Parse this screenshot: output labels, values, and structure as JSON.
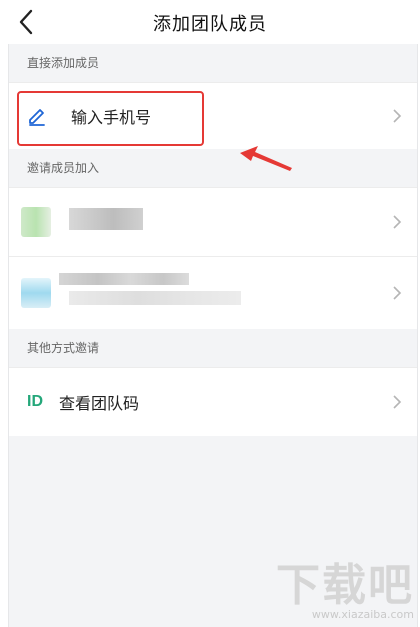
{
  "header": {
    "title": "添加团队成员"
  },
  "sections": {
    "direct": {
      "title": "直接添加成员"
    },
    "invite": {
      "title": "邀请成员加入"
    },
    "other": {
      "title": "其他方式邀请"
    }
  },
  "rows": {
    "phone": {
      "label": "输入手机号",
      "icon": "edit-pencil-icon"
    },
    "team_code": {
      "label": "查看团队码",
      "icon_text": "ID"
    }
  },
  "colors": {
    "accent_blue": "#1f66d6",
    "id_green": "#24a77a",
    "annotation_red": "#e53935",
    "background": "#f3f4f6"
  },
  "watermark": {
    "logo": "下载吧",
    "url": "www.xiazaiba.com"
  }
}
